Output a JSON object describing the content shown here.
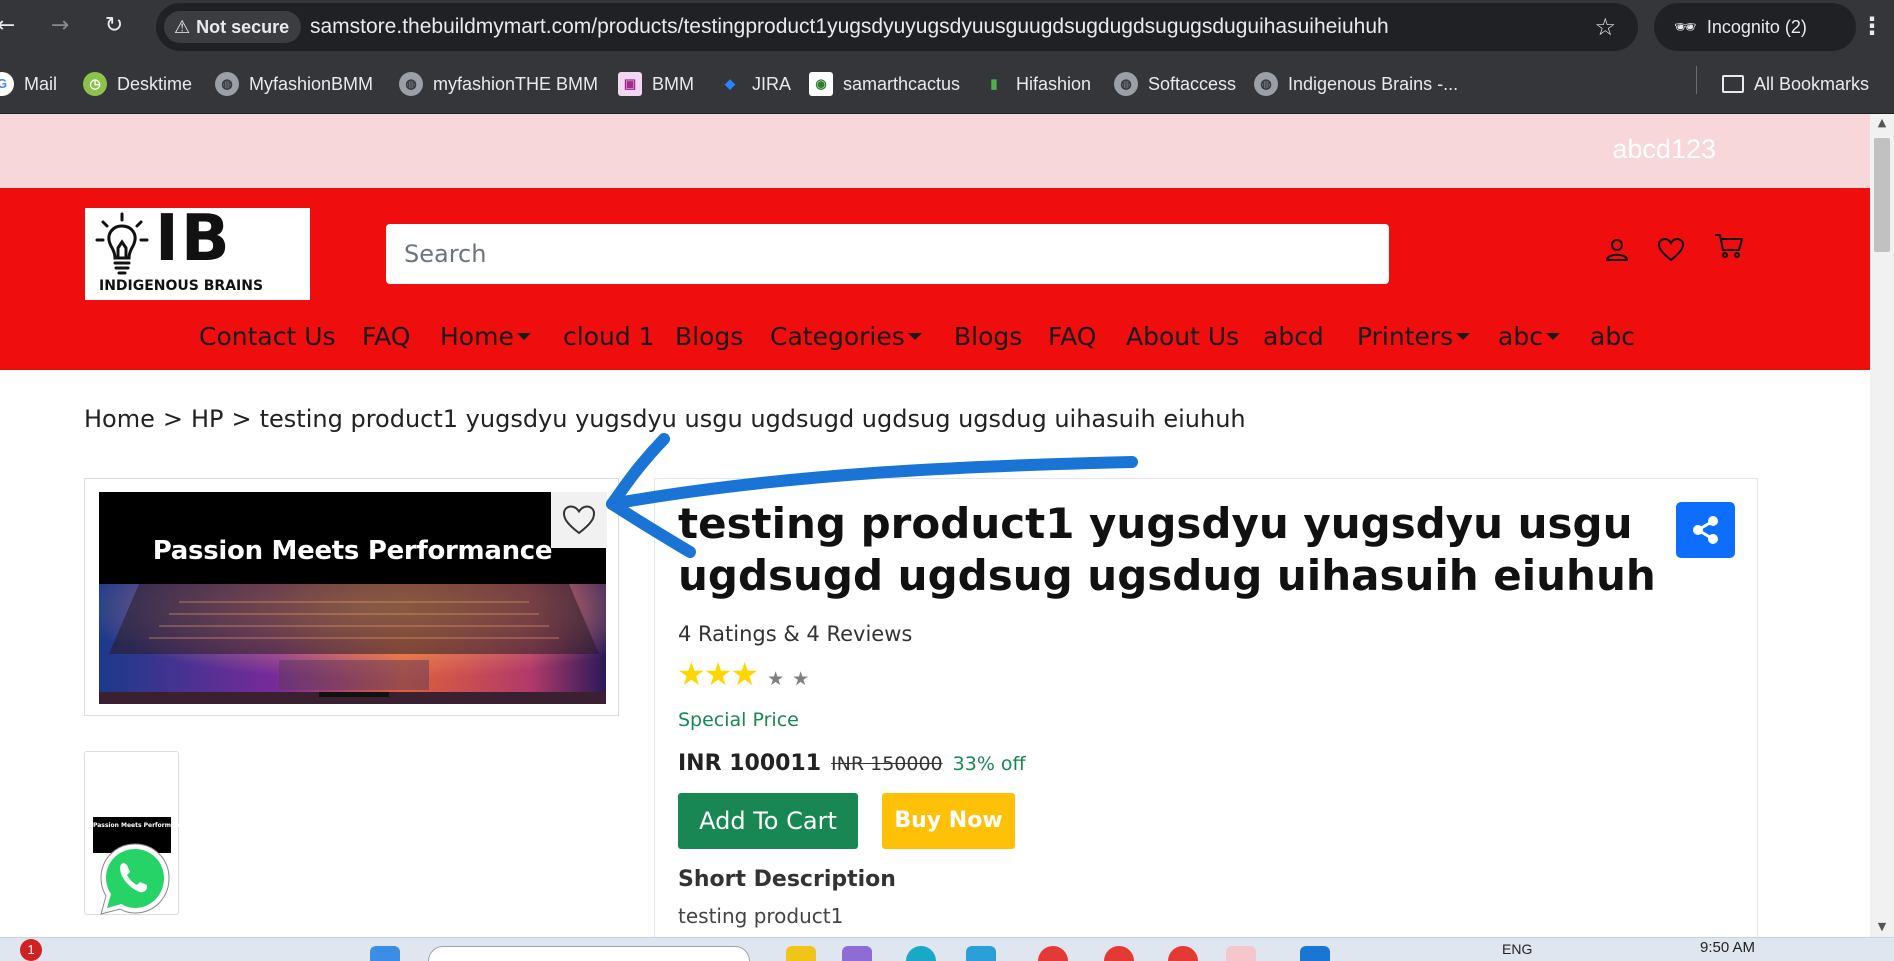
{
  "browser": {
    "security_label": "Not secure",
    "url": "samstore.thebuildmymart.com/products/testingproduct1yugsdyuyugsdyuusguugdsugdugdsugugsduguihasuiheiuhuh",
    "profile_label": "Incognito (2)"
  },
  "bookmarks": {
    "items": [
      {
        "label": "Mail",
        "icon": "google-icon"
      },
      {
        "label": "Desktime",
        "icon": "desktime-icon"
      },
      {
        "label": "MyfashionBMM",
        "icon": "globe-icon"
      },
      {
        "label": "myfashionTHE BMM",
        "icon": "globe-icon"
      },
      {
        "label": "BMM",
        "icon": "bmm-icon"
      },
      {
        "label": "JIRA",
        "icon": "jira-icon"
      },
      {
        "label": "samarthcactus",
        "icon": "cactus-icon"
      },
      {
        "label": "Hifashion",
        "icon": "hifashion-icon"
      },
      {
        "label": "Softaccess",
        "icon": "globe-icon"
      },
      {
        "label": "Indigenous Brains -...",
        "icon": "globe-icon"
      }
    ],
    "all_label": "All Bookmarks"
  },
  "promo": {
    "text": "abcd123"
  },
  "logo": {
    "letters": "IB",
    "tagline": "INDIGENOUS BRAINS"
  },
  "search": {
    "placeholder": "Search"
  },
  "nav": {
    "items": [
      {
        "label": "Contact Us",
        "dropdown": false
      },
      {
        "label": "FAQ",
        "dropdown": false
      },
      {
        "label": "Home",
        "dropdown": true
      },
      {
        "label": "cloud 1",
        "dropdown": false
      },
      {
        "label": "Blogs",
        "dropdown": false
      },
      {
        "label": "Categories",
        "dropdown": true
      },
      {
        "label": "Blogs",
        "dropdown": false
      },
      {
        "label": "FAQ",
        "dropdown": false
      },
      {
        "label": "About Us",
        "dropdown": false
      },
      {
        "label": "abcd",
        "dropdown": false
      },
      {
        "label": "Printers",
        "dropdown": true
      },
      {
        "label": "abc",
        "dropdown": true
      },
      {
        "label": "abc",
        "dropdown": false
      }
    ]
  },
  "breadcrumb": {
    "items": [
      "Home",
      "HP",
      "testing product1 yugsdyu yugsdyu usgu ugdsugd ugdsug ugsdug uihasuih eiuhuh"
    ],
    "separator": ">"
  },
  "gallery": {
    "banner_text": "Passion Meets Performance"
  },
  "product": {
    "title": "testing product1 yugsdyu yugsdyu usgu ugdsugd ugdsug ugsdug uihasuih eiuhuh",
    "ratings_text": "4 Ratings & 4 Reviews",
    "rating": 3,
    "rating_max": 5,
    "special_label": "Special Price",
    "price": "INR 100011",
    "mrp": "INR 150000",
    "discount": "33% off",
    "add_to_cart": "Add To Cart",
    "buy_now": "Buy Now",
    "short_desc_heading": "Short Description",
    "short_desc": "testing product1"
  },
  "taskbar": {
    "badge": "1",
    "lang": "ENG",
    "time": "9:50 AM"
  },
  "colors": {
    "header_red": "#ef0d0d",
    "promo_pink": "#f8d7da",
    "cart_green": "#198754",
    "buy_yellow": "#ffc107",
    "share_blue": "#0d6efd",
    "annotation_blue": "#1a74d6"
  }
}
